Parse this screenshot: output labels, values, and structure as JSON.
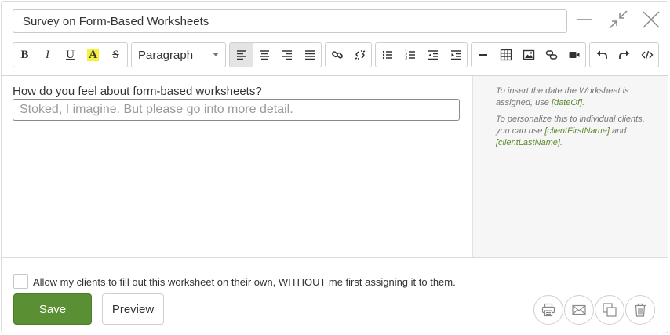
{
  "title": {
    "value": "Survey on Form-Based Worksheets"
  },
  "window_controls": [
    {
      "name": "minimize-icon"
    },
    {
      "name": "collapse-icon"
    },
    {
      "name": "close-icon"
    }
  ],
  "toolbar": {
    "bold": "B",
    "italic": "I",
    "underline": "U",
    "highlight": "A",
    "strike": "S",
    "format": "Paragraph",
    "icons": [
      "align-left-icon",
      "align-center-icon",
      "align-right-icon",
      "align-justify-icon",
      "link-icon",
      "unlink-icon",
      "bullet-list-icon",
      "numbered-list-icon",
      "outdent-icon",
      "indent-icon",
      "horizontal-rule-icon",
      "table-icon",
      "image-icon",
      "embed-icon",
      "video-icon",
      "undo-icon",
      "redo-icon",
      "code-icon"
    ]
  },
  "editor": {
    "question": "How do you feel about form-based worksheets?",
    "answer_placeholder": "Stoked, I imagine. But please go into more detail."
  },
  "sidebar": {
    "p1_text": "To insert the date the Worksheet is assigned, use ",
    "p1_tag": "[dateOf]",
    "p1_end": ".",
    "p2_text": "To personalize this to individual clients, you can use ",
    "p2_tag1": "[clientFirstName]",
    "p2_and": " and ",
    "p2_tag2": "[clientLastName]",
    "p2_end": "."
  },
  "footer": {
    "checkbox_label": "Allow my clients to fill out this worksheet on their own, WITHOUT me first assigning it to them.",
    "checkbox_checked": false,
    "save_label": "Save",
    "preview_label": "Preview",
    "icons": [
      "print-icon",
      "email-icon",
      "duplicate-icon",
      "trash-icon"
    ]
  },
  "colors": {
    "accent": "#5a8f34",
    "tag": "#5d8a2e"
  }
}
